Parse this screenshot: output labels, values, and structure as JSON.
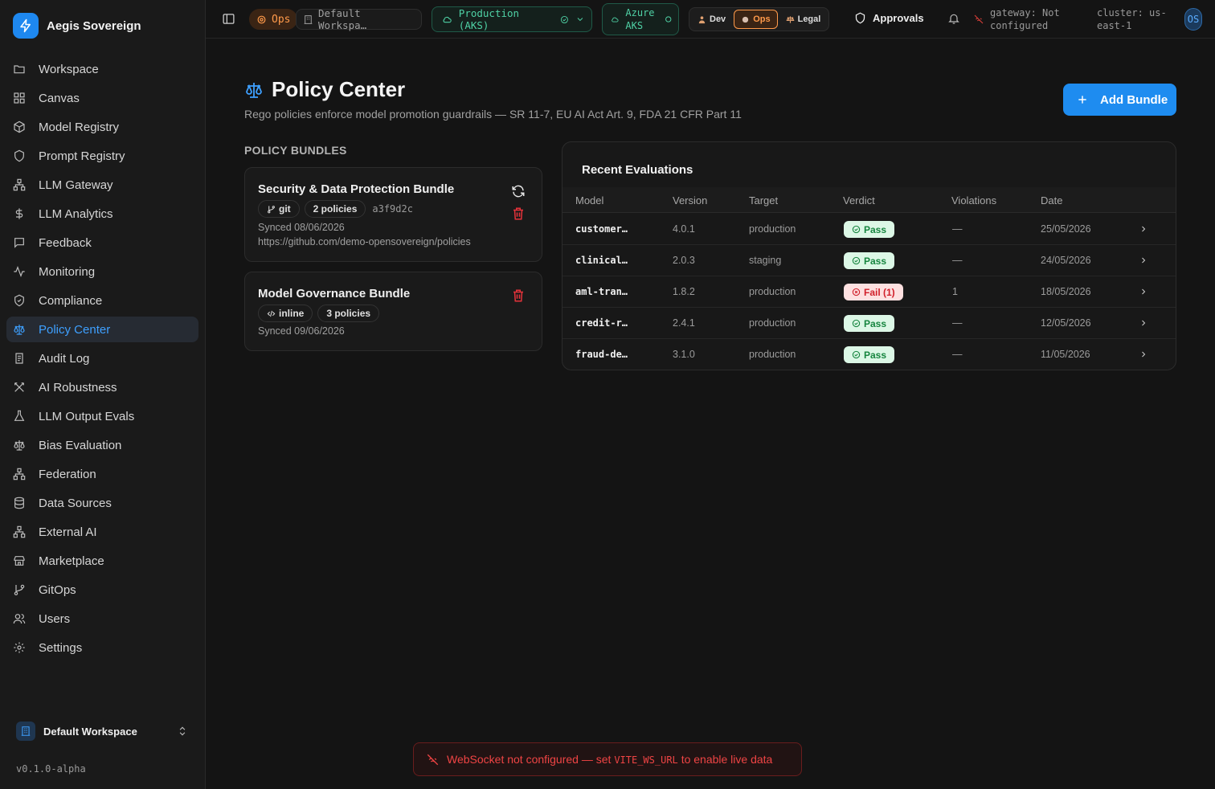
{
  "brand": {
    "name": "Aegis Sovereign"
  },
  "sidebar": {
    "items": [
      {
        "label": "Workspace"
      },
      {
        "label": "Canvas"
      },
      {
        "label": "Model Registry"
      },
      {
        "label": "Prompt Registry"
      },
      {
        "label": "LLM Gateway"
      },
      {
        "label": "LLM Analytics"
      },
      {
        "label": "Feedback"
      },
      {
        "label": "Monitoring"
      },
      {
        "label": "Compliance"
      },
      {
        "label": "Policy Center",
        "active": true
      },
      {
        "label": "Audit Log"
      },
      {
        "label": "AI Robustness"
      },
      {
        "label": "LLM Output Evals"
      },
      {
        "label": "Bias Evaluation"
      },
      {
        "label": "Federation"
      },
      {
        "label": "Data Sources"
      },
      {
        "label": "External AI"
      },
      {
        "label": "Marketplace"
      },
      {
        "label": "GitOps"
      },
      {
        "label": "Users"
      },
      {
        "label": "Settings"
      }
    ],
    "workspace": "Default Workspace",
    "version": "v0.1.0-alpha"
  },
  "topbar": {
    "role_badge": "Ops",
    "workspace": "Default Workspa…",
    "environment": "Production (AKS)",
    "cloud_line1": "Azure",
    "cloud_line2": "AKS",
    "personas": [
      "Dev",
      "Ops",
      "Legal"
    ],
    "active_persona": "Ops",
    "approvals": "Approvals",
    "gateway_line1": "gateway: Not",
    "gateway_line2": "configured",
    "cluster_line1": "cluster: us-",
    "cluster_line2": "east-1",
    "avatar": "OS"
  },
  "page": {
    "title": "Policy Center",
    "subtitle": "Rego policies enforce model promotion guardrails — SR 11-7, EU AI Act Art. 9, FDA 21 CFR Part 11",
    "add_button": "Add Bundle",
    "bundles_heading": "POLICY BUNDLES"
  },
  "bundles": [
    {
      "title": "Security & Data Protection Bundle",
      "source": "git",
      "policies": "2 policies",
      "sha": "a3f9d2c",
      "synced": "Synced 08/06/2026",
      "url": "https://github.com/demo-opensovereign/policies"
    },
    {
      "title": "Model Governance Bundle",
      "source": "inline",
      "policies": "3 policies",
      "synced": "Synced 09/06/2026"
    }
  ],
  "evaluations": {
    "title": "Recent Evaluations",
    "columns": [
      "Model",
      "Version",
      "Target",
      "Verdict",
      "Violations",
      "Date"
    ],
    "rows": [
      {
        "model": "customer…",
        "version": "4.0.1",
        "target": "production",
        "verdict": "Pass",
        "status": "pass",
        "violations": "—",
        "date": "25/05/2026"
      },
      {
        "model": "clinical…",
        "version": "2.0.3",
        "target": "staging",
        "verdict": "Pass",
        "status": "pass",
        "violations": "—",
        "date": "24/05/2026"
      },
      {
        "model": "aml-tran…",
        "version": "1.8.2",
        "target": "production",
        "verdict": "Fail (1)",
        "status": "fail",
        "violations": "1",
        "date": "18/05/2026"
      },
      {
        "model": "credit-r…",
        "version": "2.4.1",
        "target": "production",
        "verdict": "Pass",
        "status": "pass",
        "violations": "—",
        "date": "12/05/2026"
      },
      {
        "model": "fraud-de…",
        "version": "3.1.0",
        "target": "production",
        "verdict": "Pass",
        "status": "pass",
        "violations": "—",
        "date": "11/05/2026"
      }
    ]
  },
  "toast": {
    "before": "WebSocket not configured — set",
    "code": "VITE_WS_URL",
    "after": "to enable live data"
  },
  "colors": {
    "accent": "#1e8cf0",
    "active_nav": "#3ea0ff",
    "ops": "#ff9a4a",
    "env": "#4fd1a5",
    "pass": "#16853f",
    "fail": "#d11f2a",
    "error": "#ef4444"
  }
}
